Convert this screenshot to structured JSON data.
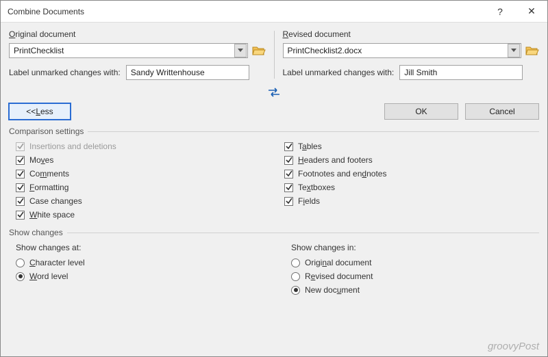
{
  "window": {
    "title": "Combine Documents",
    "help": "?",
    "close": "✕"
  },
  "original": {
    "group_label_pre": "O",
    "group_label_post": "riginal document",
    "value": "PrintChecklist",
    "label_with": "Label unmarked changes with:",
    "person": "Sandy Writtenhouse"
  },
  "revised": {
    "group_label_pre": "R",
    "group_label_post": "evised document",
    "value": "PrintChecklist2.docx",
    "label_with": "Label unmarked changes with:",
    "person": "Jill Smith"
  },
  "buttons": {
    "less_pre": "<< ",
    "less_u": "L",
    "less_post": "ess",
    "ok": "OK",
    "cancel": "Cancel"
  },
  "comparison": {
    "title": "Comparison settings",
    "left": [
      {
        "label_pre": "",
        "u": "",
        "label_post": "Insertions and deletions",
        "checked": true,
        "disabled": true
      },
      {
        "label_pre": "Mo",
        "u": "v",
        "label_post": "es",
        "checked": true,
        "disabled": false
      },
      {
        "label_pre": "Co",
        "u": "m",
        "label_post": "ments",
        "checked": true,
        "disabled": false
      },
      {
        "label_pre": "",
        "u": "F",
        "label_post": "ormatting",
        "checked": true,
        "disabled": false
      },
      {
        "label_pre": "Case chan",
        "u": "g",
        "label_post": "es",
        "checked": true,
        "disabled": false
      },
      {
        "label_pre": "",
        "u": "W",
        "label_post": "hite space",
        "checked": true,
        "disabled": false
      }
    ],
    "right": [
      {
        "label_pre": "T",
        "u": "a",
        "label_post": "bles",
        "checked": true,
        "disabled": false
      },
      {
        "label_pre": "",
        "u": "H",
        "label_post": "eaders and footers",
        "checked": true,
        "disabled": false
      },
      {
        "label_pre": "Footnotes and en",
        "u": "d",
        "label_post": "notes",
        "checked": true,
        "disabled": false
      },
      {
        "label_pre": "Te",
        "u": "x",
        "label_post": "tboxes",
        "checked": true,
        "disabled": false
      },
      {
        "label_pre": "F",
        "u": "i",
        "label_post": "elds",
        "checked": true,
        "disabled": false
      }
    ]
  },
  "show_changes": {
    "title": "Show changes",
    "at_label": "Show changes at:",
    "at_options": [
      {
        "label_pre": "",
        "u": "C",
        "label_post": "haracter level",
        "selected": false
      },
      {
        "label_pre": "",
        "u": "W",
        "label_post": "ord level",
        "selected": true
      }
    ],
    "in_label": "Show changes in:",
    "in_options": [
      {
        "label_pre": "Origi",
        "u": "n",
        "label_post": "al document",
        "selected": false
      },
      {
        "label_pre": "R",
        "u": "e",
        "label_post": "vised document",
        "selected": false
      },
      {
        "label_pre": "New doc",
        "u": "u",
        "label_post": "ment",
        "selected": true
      }
    ]
  },
  "watermark": "groovyPost"
}
